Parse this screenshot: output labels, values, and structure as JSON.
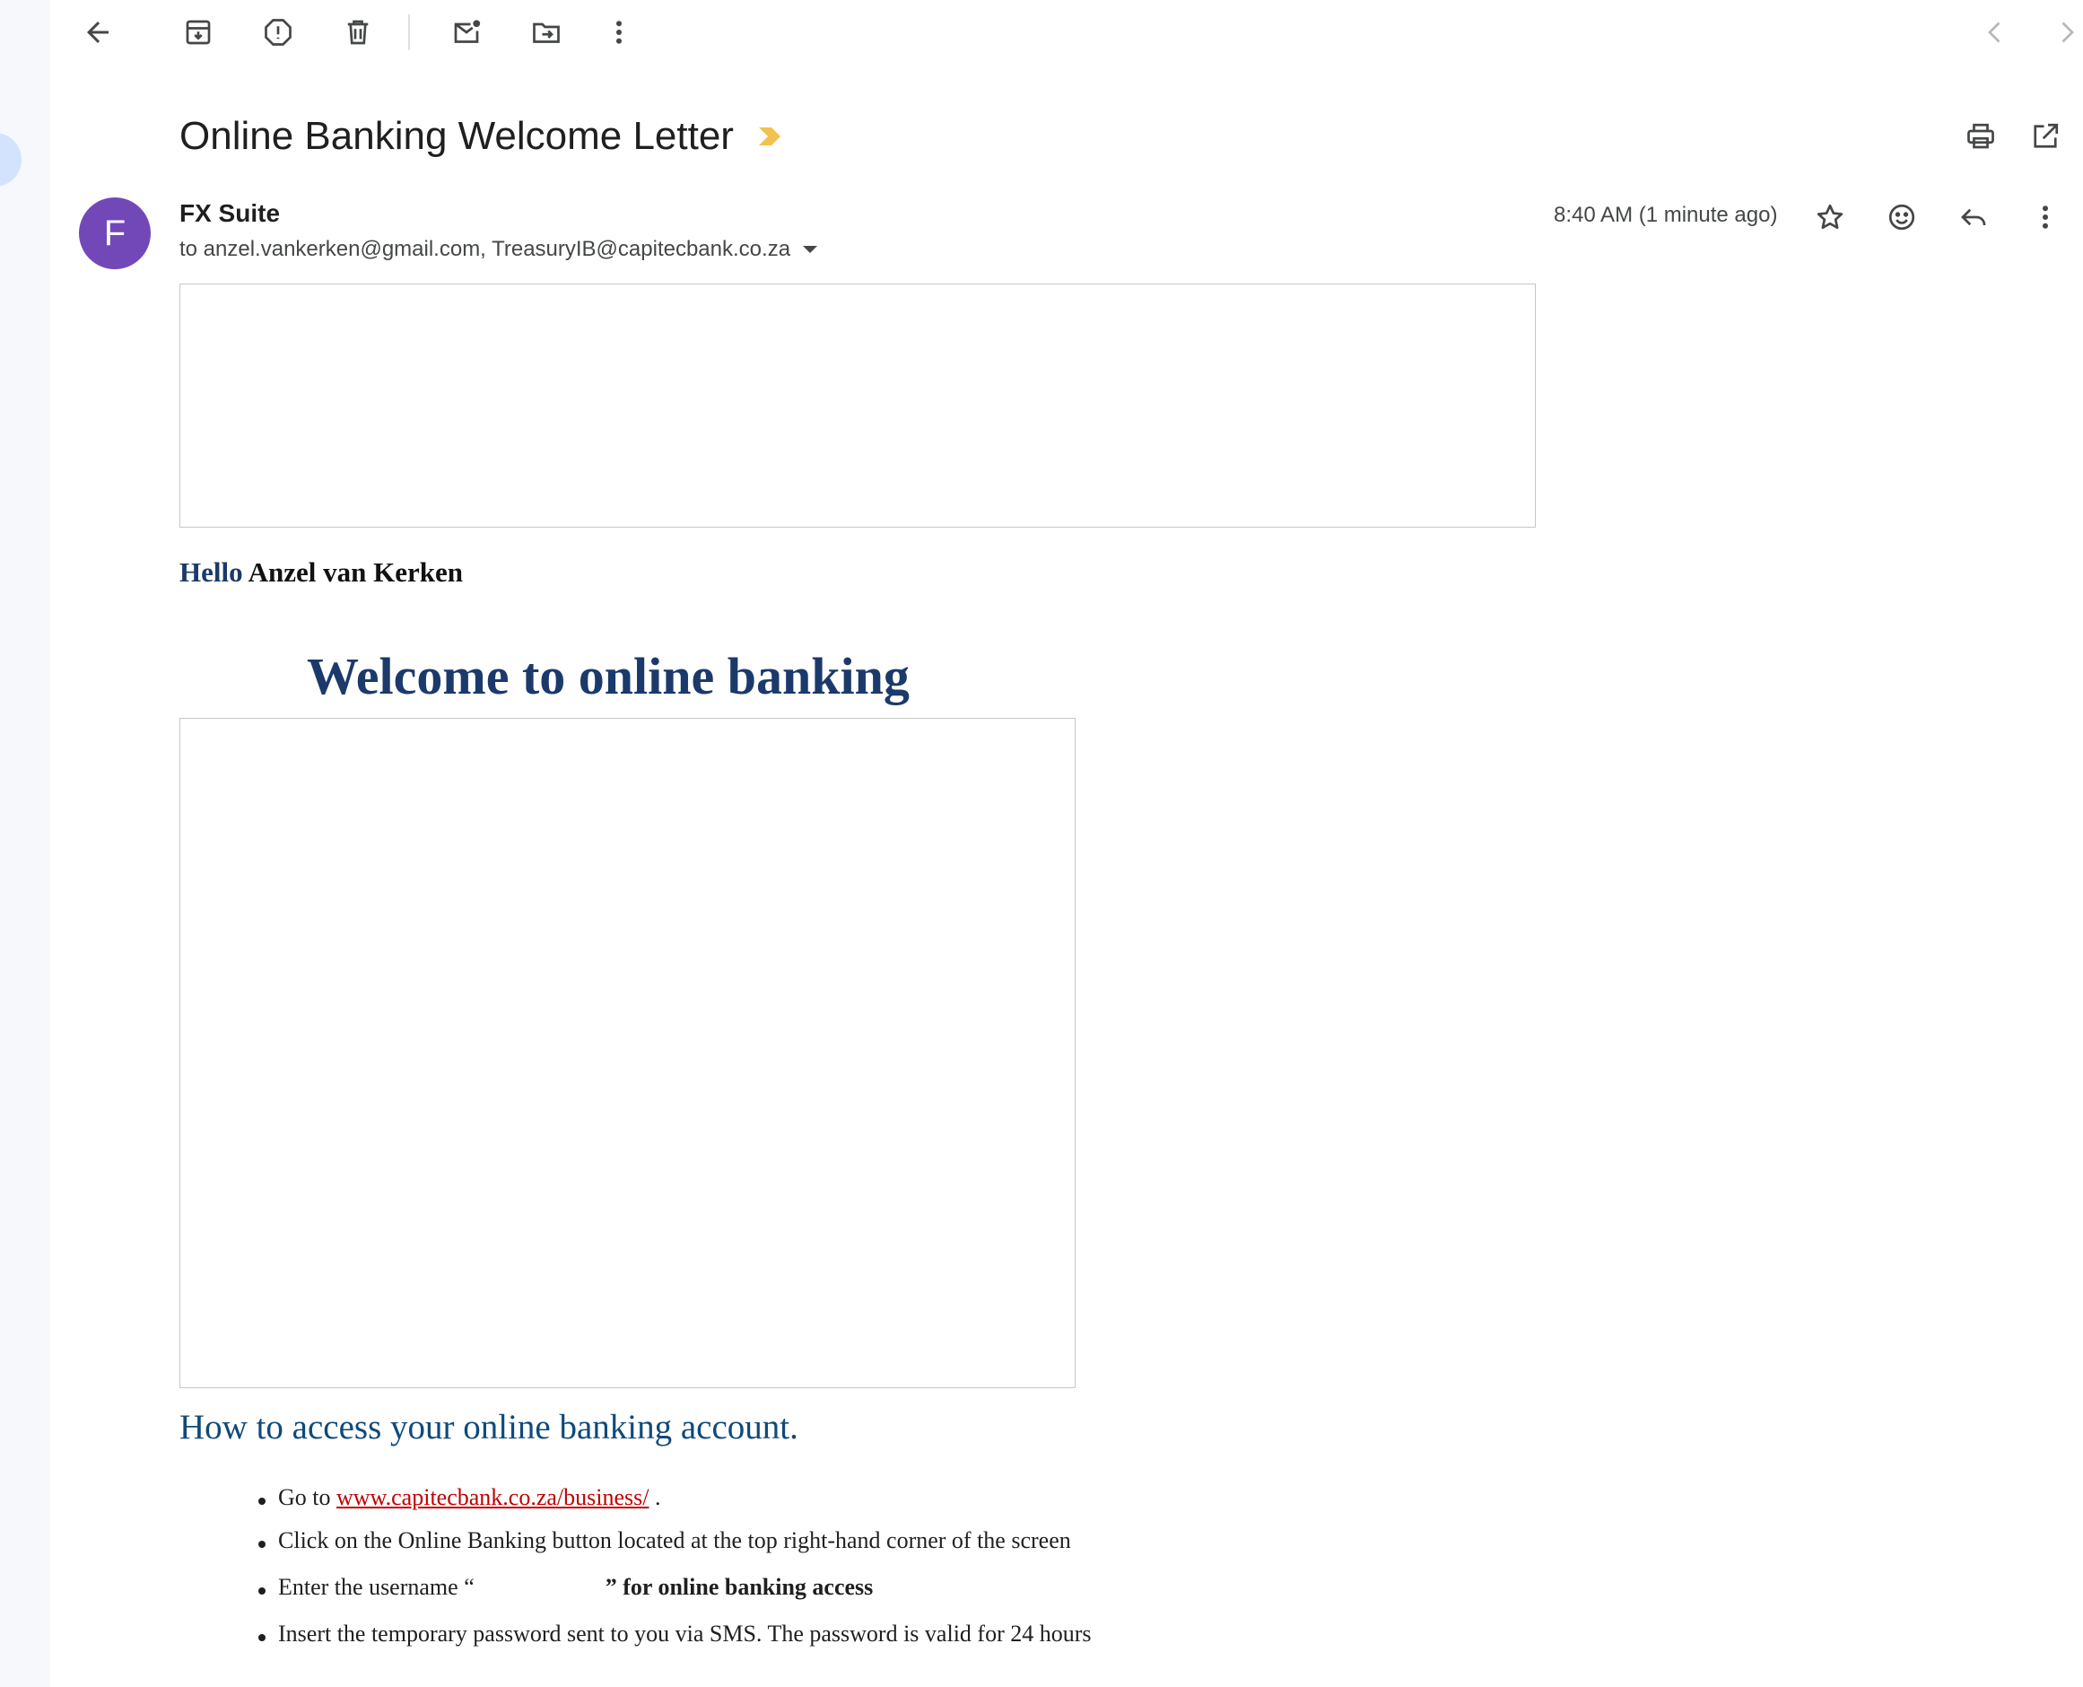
{
  "email": {
    "subject": "Online Banking Welcome Letter",
    "sender": {
      "name": "FX Suite",
      "avatar_letter": "F",
      "avatar_color": "#7248b9"
    },
    "recipients": "to anzel.vankerken@gmail.com, TreasuryIB@capitecbank.co.za",
    "timestamp": "8:40 AM (1 minute ago)"
  },
  "body": {
    "greeting_hello": "Hello",
    "greeting_name": "Anzel van Kerken",
    "welcome_heading": "Welcome to online banking",
    "howto_heading": "How to access your online banking account.",
    "steps": {
      "s1": {
        "prefix": "Go to",
        "link": "www.capitecbank.co.za/business/",
        "suffix": "."
      },
      "s2": {
        "text": "Click on the Online Banking button located at the top right-hand corner of the screen"
      },
      "s3": {
        "prefix": "Enter the username “",
        "close_quote": "”",
        "bold_suffix": "for online banking access"
      },
      "s4": {
        "text": "Insert the temporary password sent to you via SMS. The password is valid for 24 hours"
      }
    }
  },
  "colors": {
    "heading_navy": "#1b3a6b",
    "howto_blue": "#0e4a7a",
    "link_red": "#c00000",
    "importance_yellow": "#f2c14e"
  },
  "icons": {
    "toolbar": [
      "back-arrow-icon",
      "archive-icon",
      "report-spam-icon",
      "delete-icon",
      "mark-unread-icon",
      "move-to-icon",
      "more-vert-icon"
    ],
    "nav": [
      "newer-chevron-icon",
      "older-chevron-icon"
    ],
    "header": [
      "print-icon",
      "open-new-window-icon"
    ],
    "message": [
      "star-icon",
      "emoji-reaction-icon",
      "reply-icon",
      "more-vert-icon"
    ]
  }
}
